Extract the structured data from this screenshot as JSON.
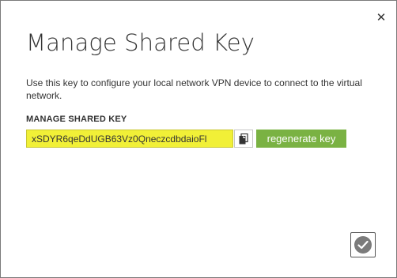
{
  "dialog": {
    "title": "Manage Shared Key",
    "description": "Use this key to configure your local network VPN device to connect to the virtual network.",
    "close_icon": "close-icon",
    "close_glyph": "✕"
  },
  "shared_key": {
    "label": "MANAGE SHARED KEY",
    "value": "xSDYR6qeDdUGB63Vz0QneczcdbdaioFl",
    "copy_icon": "copy-icon",
    "regenerate_label": "regenerate key"
  },
  "footer": {
    "confirm_icon": "checkmark-icon"
  },
  "colors": {
    "key_highlight": "#f1f037",
    "accent_green": "#7ab243",
    "text": "#333333"
  }
}
